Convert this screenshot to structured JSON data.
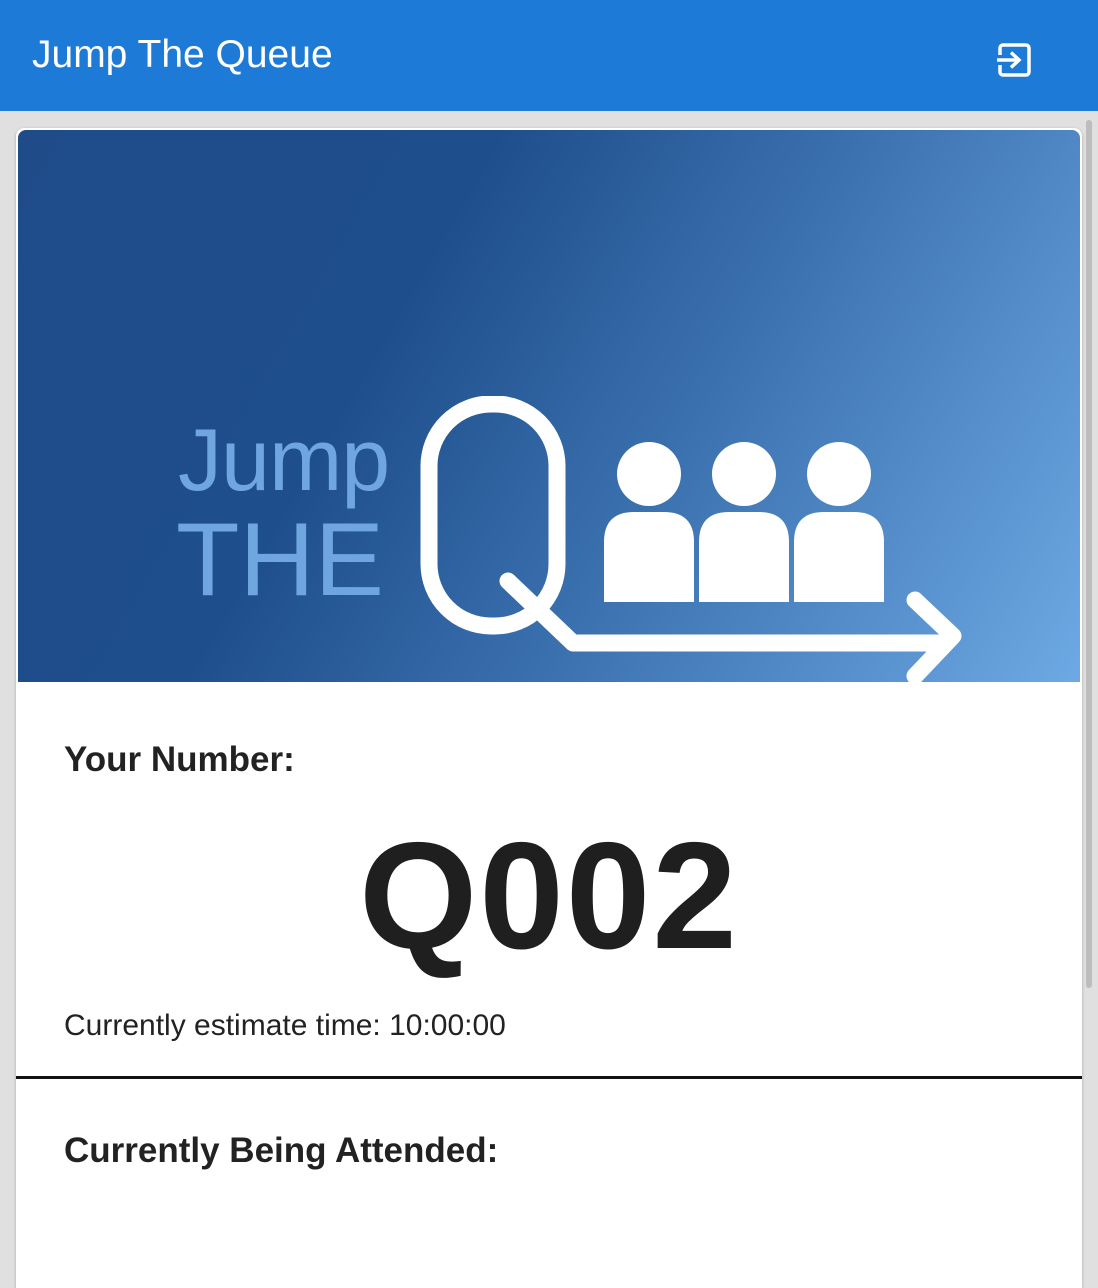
{
  "toolbar": {
    "title": "Jump The Queue",
    "logout_icon": "logout-icon"
  },
  "banner": {
    "logo_text_top": "Jump",
    "logo_text_bottom": "THE",
    "logo_icon": "queue-people-arrow-icon"
  },
  "ticket": {
    "your_number_label": "Your Number:",
    "number": "Q002",
    "estimate_text": "Currently estimate time: 10:00:00"
  },
  "attended": {
    "label": "Currently Being Attended:"
  },
  "colors": {
    "toolbar_bg": "#1d7ad7",
    "banner_dark": "#1f4b89",
    "banner_light": "#6da9e4",
    "logo_text": "#6fa6e0"
  }
}
